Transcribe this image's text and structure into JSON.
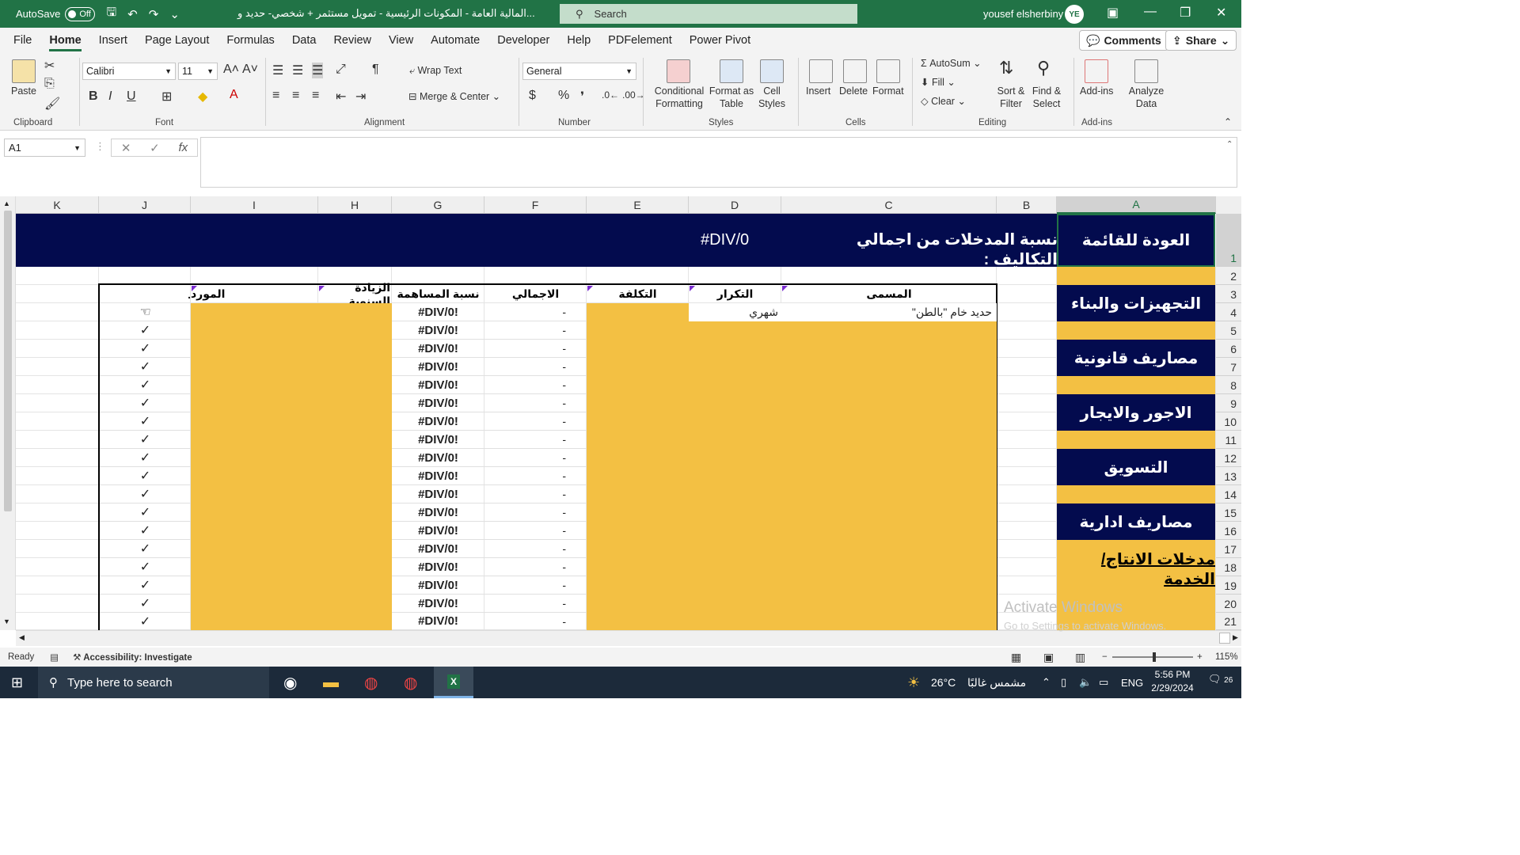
{
  "titlebar": {
    "autosave_label": "AutoSave",
    "autosave_state": "Off",
    "doc_title": "المالية العامة - المكونات الرئيسية - تمويل مستثمر + شخصي- حديد و...",
    "search_placeholder": "Search",
    "user_name": "yousef elsherbiny",
    "user_initials": "YE"
  },
  "menu": {
    "tabs": [
      "File",
      "Home",
      "Insert",
      "Page Layout",
      "Formulas",
      "Data",
      "Review",
      "View",
      "Automate",
      "Developer",
      "Help",
      "PDFelement",
      "Power Pivot"
    ],
    "active": "Home",
    "comments": "Comments",
    "share": "Share"
  },
  "ribbon": {
    "clipboard": {
      "label": "Clipboard",
      "paste": "Paste"
    },
    "font": {
      "label": "Font",
      "name": "Calibri",
      "size": "11"
    },
    "alignment": {
      "label": "Alignment",
      "wrap": "Wrap Text",
      "merge": "Merge & Center"
    },
    "number": {
      "label": "Number",
      "format": "General"
    },
    "styles": {
      "label": "Styles",
      "conditional": "Conditional Formatting",
      "format_table": "Format as Table",
      "cell_styles": "Cell Styles"
    },
    "cells": {
      "label": "Cells",
      "insert": "Insert",
      "delete": "Delete",
      "format": "Format"
    },
    "editing": {
      "label": "Editing",
      "autosum": "AutoSum",
      "fill": "Fill",
      "clear": "Clear",
      "sort": "Sort & Filter",
      "find": "Find & Select"
    },
    "addins": {
      "label": "Add-ins",
      "addins": "Add-ins",
      "analyze": "Analyze Data"
    }
  },
  "formula_bar": {
    "name_box": "A1",
    "formula": ""
  },
  "columns": [
    "K",
    "J",
    "I",
    "H",
    "G",
    "F",
    "E",
    "D",
    "C",
    "B",
    "A"
  ],
  "rows": [
    "1",
    "2",
    "3",
    "4",
    "5",
    "6",
    "7",
    "8",
    "9",
    "10",
    "11",
    "12",
    "13",
    "14",
    "15",
    "16",
    "17",
    "18",
    "19",
    "20",
    "21"
  ],
  "banner": {
    "label": "نسبة المدخلات من اجمالي التكاليف :",
    "value": "#DIV/0"
  },
  "nav": {
    "back": "العودة للقائمة",
    "equipment": "التجهيزات والبناء",
    "legal": "مصاريف قانونية",
    "wages": "الاجور والايجار",
    "marketing": "التسويق",
    "admin": "مصاريف ادارية",
    "inputs": "مدخلات الانتاج/الخدمة"
  },
  "table": {
    "headers": {
      "name": "المسمى",
      "frequency": "التكرار",
      "cost": "التكلفة",
      "total": "الاجمالي",
      "share": "نسبة المساهمة",
      "annual": "الزيادة السنوية",
      "supplier": "المورد",
      "mark": "."
    },
    "first_row": {
      "name": "حديد خام \"بالطن\"",
      "frequency": "شهري"
    },
    "share_value": "#DIV/0!",
    "total_value": "-",
    "first_mark": "☜",
    "check": "✓"
  },
  "status": {
    "ready": "Ready",
    "accessibility": "Accessibility: Investigate",
    "zoom": "115%"
  },
  "watermark": {
    "line1": "Activate Windows",
    "line2": "Go to Settings to activate Windows."
  },
  "taskbar": {
    "search_placeholder": "Type here to search",
    "temp": "26°C",
    "weather": "مشمس غالبًا",
    "lang": "ENG",
    "time": "5:56 PM",
    "date": "2/29/2024",
    "notif": "26"
  }
}
